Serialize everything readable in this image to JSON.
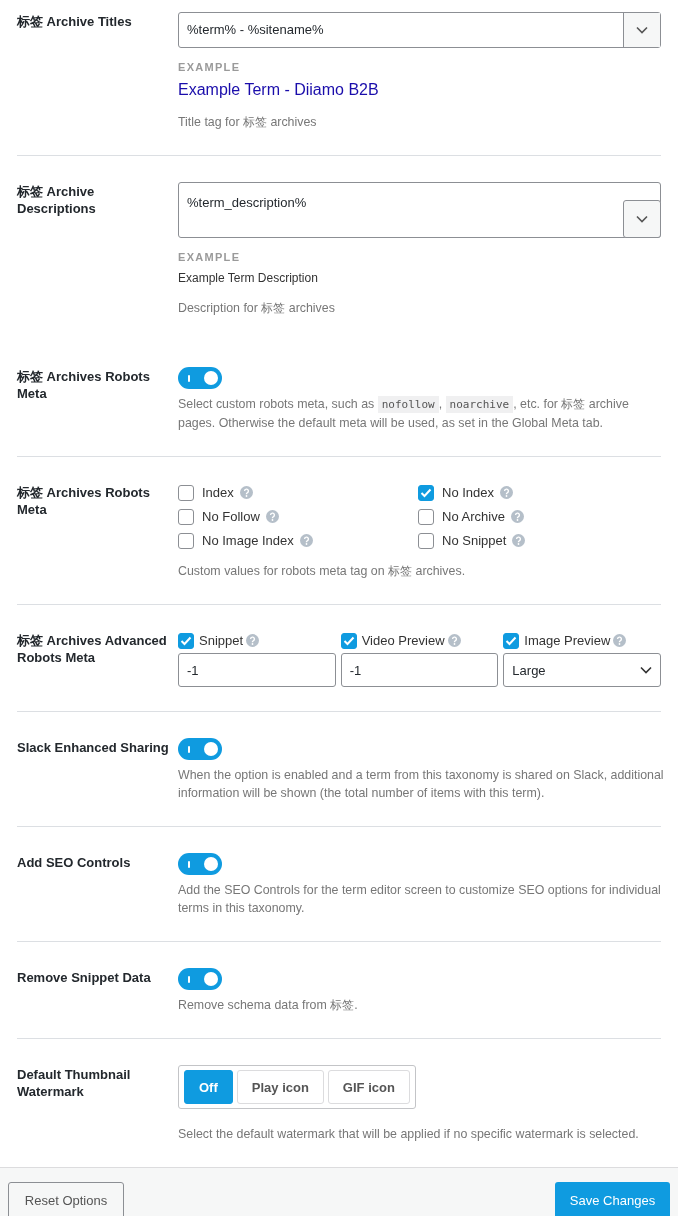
{
  "rows": [
    {
      "kind": "select_input",
      "separated": false,
      "label": "标签 Archive Titles",
      "value": "%term% - %sitename%",
      "example_heading": "EXAMPLE",
      "example": {
        "kind": "link",
        "text": "Example Term - Diiamo B2B"
      },
      "description": [
        {
          "kind": "text",
          "text": "Title tag for 标签 archives"
        }
      ]
    },
    {
      "kind": "textarea_input",
      "separated": true,
      "label": "标签 Archive Descriptions",
      "value": "%term_description%",
      "example_heading": "EXAMPLE",
      "example": {
        "kind": "plain",
        "text": "Example Term Description"
      },
      "description": [
        {
          "kind": "text",
          "text": "Description for 标签 archives"
        }
      ]
    },
    {
      "kind": "toggle",
      "separated": false,
      "label": "标签 Archives Robots Meta",
      "on": true,
      "description": [
        {
          "kind": "text",
          "text": "Select custom robots meta, such as "
        },
        {
          "kind": "code",
          "text": "nofollow"
        },
        {
          "kind": "text",
          "text": ", "
        },
        {
          "kind": "code",
          "text": "noarchive"
        },
        {
          "kind": "text",
          "text": ", etc. for 标签 archive pages. Otherwise the default meta will be used, as set in the Global Meta tab."
        }
      ]
    },
    {
      "kind": "checkbox_grid",
      "separated": true,
      "label": "标签 Archives Robots Meta",
      "options": [
        {
          "label": "Index",
          "checked": false
        },
        {
          "label": "No Index",
          "checked": true
        },
        {
          "label": "No Follow",
          "checked": false
        },
        {
          "label": "No Archive",
          "checked": false
        },
        {
          "label": "No Image Index",
          "checked": false
        },
        {
          "label": "No Snippet",
          "checked": false
        }
      ],
      "description": [
        {
          "kind": "text",
          "text": "Custom values for robots meta tag on 标签 archives."
        }
      ]
    },
    {
      "kind": "advanced",
      "separated": true,
      "label": "标签 Archives Advanced Robots Meta",
      "fields": [
        {
          "label": "Snippet",
          "checked": true,
          "kind": "input",
          "value": "-1"
        },
        {
          "label": "Video Preview",
          "checked": true,
          "kind": "input",
          "value": "-1"
        },
        {
          "label": "Image Preview",
          "checked": true,
          "kind": "select",
          "value": "Large"
        }
      ]
    },
    {
      "kind": "toggle",
      "separated": true,
      "label": "Slack Enhanced Sharing",
      "on": true,
      "description": [
        {
          "kind": "text",
          "text": "When the option is enabled and a term from this taxonomy is shared on Slack, additional information will be shown (the total number of items with this term)."
        }
      ]
    },
    {
      "kind": "toggle",
      "separated": true,
      "label": "Add SEO Controls",
      "on": true,
      "description": [
        {
          "kind": "text",
          "text": "Add the SEO Controls for the term editor screen to customize SEO options for individual terms in this taxonomy."
        }
      ]
    },
    {
      "kind": "toggle",
      "separated": true,
      "label": "Remove Snippet Data",
      "on": true,
      "description": [
        {
          "kind": "text",
          "text": "Remove schema data from 标签."
        }
      ]
    },
    {
      "kind": "button_group",
      "separated": true,
      "label": "Default Thumbnail Watermark",
      "options": [
        {
          "label": "Off",
          "selected": true
        },
        {
          "label": "Play icon",
          "selected": false
        },
        {
          "label": "GIF icon",
          "selected": false
        }
      ],
      "description": [
        {
          "kind": "text",
          "text": "Select the default watermark that will be applied if no specific watermark is selected."
        }
      ]
    }
  ],
  "footer": {
    "reset": "Reset Options",
    "save": "Save Changes"
  }
}
